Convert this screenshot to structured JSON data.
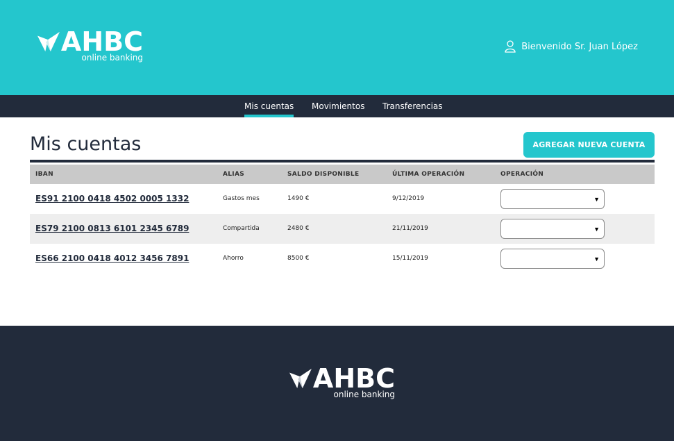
{
  "header": {
    "logo": {
      "name": "AHBC",
      "tagline": "online banking"
    },
    "welcome": "Bienvenido Sr. Juan López"
  },
  "nav": {
    "items": [
      {
        "label": "Mis cuentas",
        "active": true
      },
      {
        "label": "Movimientos",
        "active": false
      },
      {
        "label": "Transferencias",
        "active": false
      }
    ]
  },
  "main": {
    "title": "Mis cuentas",
    "add_button": "AGREGAR NUEVA CUENTA",
    "columns": [
      "IBAN",
      "ALIAS",
      "SALDO DISPONIBLE",
      "ÚLTIMA OPERACIÓN",
      "OPERACIÓN"
    ],
    "accounts": [
      {
        "iban": "ES91 2100 0418 4502 0005 1332",
        "alias": "Gastos mes",
        "saldo": "1490 €",
        "ultima": "9/12/2019",
        "operacion": ""
      },
      {
        "iban": "ES79 2100 0813 6101 2345 6789",
        "alias": "Compartida",
        "saldo": "2480 €",
        "ultima": "21/11/2019",
        "operacion": ""
      },
      {
        "iban": "ES66 2100 0418 4012 3456 7891",
        "alias": "Ahorro",
        "saldo": "8500 €",
        "ultima": "15/11/2019",
        "operacion": ""
      }
    ]
  },
  "footer": {
    "logo": {
      "name": "AHBC",
      "tagline": "online banking"
    }
  },
  "colors": {
    "accent": "#24c6cd",
    "dark": "#222b3b",
    "table_header": "#c9c9c9",
    "row_alt": "#eeeeee"
  },
  "icons": [
    "logo-mark-icon",
    "user-icon",
    "chevron-down-icon"
  ]
}
